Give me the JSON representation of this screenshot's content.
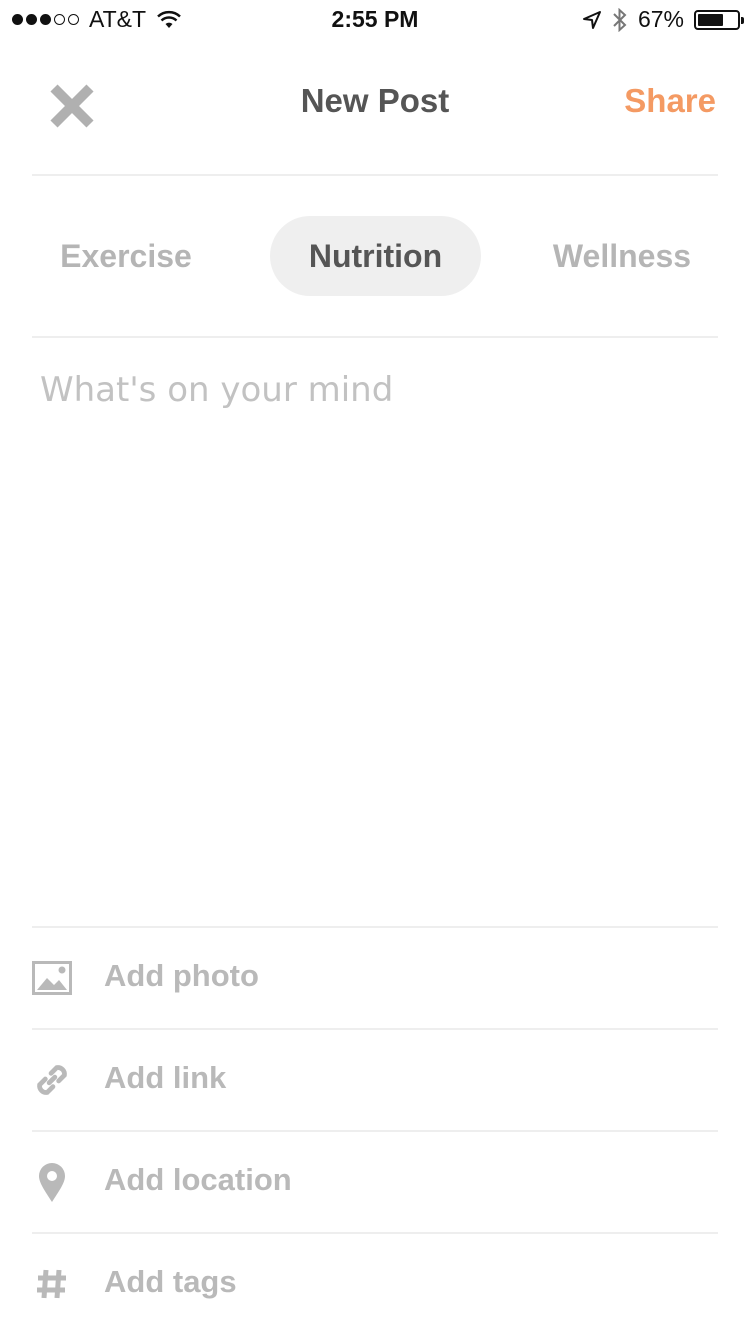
{
  "status_bar": {
    "carrier": "AT&T",
    "time": "2:55 PM",
    "battery": "67%",
    "battery_level": 0.67,
    "signal_dots": [
      true,
      true,
      true,
      false,
      false
    ]
  },
  "nav": {
    "title": "New Post",
    "share_label": "Share",
    "close_icon": "close-icon"
  },
  "tabs": [
    {
      "label": "Exercise",
      "active": false
    },
    {
      "label": "Nutrition",
      "active": true
    },
    {
      "label": "Wellness",
      "active": false
    }
  ],
  "composer": {
    "placeholder": "What's on your mind",
    "value": ""
  },
  "actions": [
    {
      "label": "Add photo",
      "icon": "photo-icon"
    },
    {
      "label": "Add link",
      "icon": "link-icon"
    },
    {
      "label": "Add location",
      "icon": "location-pin-icon"
    },
    {
      "label": "Add tags",
      "icon": "hashtag-icon"
    }
  ],
  "colors": {
    "accent": "#f49a63",
    "muted_text": "#b9b9b9",
    "title_text": "#555555",
    "active_tab_bg": "#efefef"
  }
}
